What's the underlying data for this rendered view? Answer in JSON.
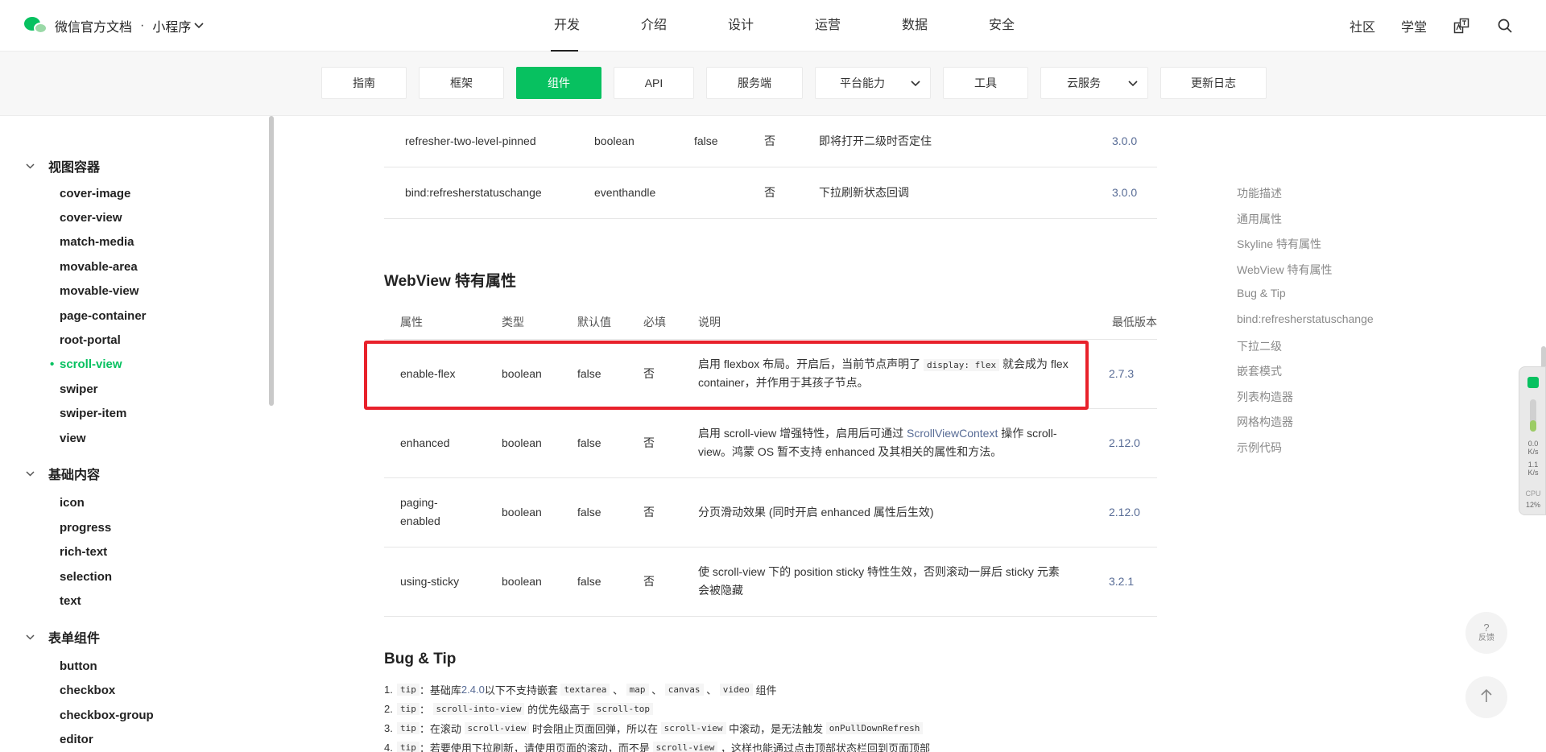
{
  "topnav": {
    "site_title": "微信官方文档",
    "separator": "·",
    "product": "小程序",
    "items": [
      "开发",
      "介绍",
      "设计",
      "运营",
      "数据",
      "安全"
    ],
    "active": "开发",
    "right_links": [
      "社区",
      "学堂"
    ]
  },
  "subnav": {
    "tabs": [
      "指南",
      "框架",
      "组件",
      "API",
      "服务端",
      "平台能力",
      "工具",
      "云服务",
      "更新日志"
    ],
    "active": "组件"
  },
  "sidebar": {
    "groups": [
      {
        "title": "视图容器",
        "items": [
          "cover-image",
          "cover-view",
          "match-media",
          "movable-area",
          "movable-view",
          "page-container",
          "root-portal",
          "scroll-view",
          "swiper",
          "swiper-item",
          "view"
        ]
      },
      {
        "title": "基础内容",
        "items": [
          "icon",
          "progress",
          "rich-text",
          "selection",
          "text"
        ]
      },
      {
        "title": "表单组件",
        "items": [
          "button",
          "checkbox",
          "checkbox-group",
          "editor"
        ]
      }
    ],
    "active_item": "scroll-view"
  },
  "prev_table": {
    "rows": [
      {
        "name": "refresher-two-level-pinned",
        "type": "boolean",
        "default": "false",
        "required": "否",
        "desc": "即将打开二级时否定住",
        "version": "3.0.0"
      },
      {
        "name": "bind:refresherstatuschange",
        "type": "eventhandle",
        "default": "",
        "required": "否",
        "desc": "下拉刷新状态回调",
        "version": "3.0.0"
      }
    ]
  },
  "webview": {
    "title": "WebView 特有属性",
    "headers": [
      "属性",
      "类型",
      "默认值",
      "必填",
      "说明",
      "最低版本"
    ],
    "rows": [
      {
        "name": "enable-flex",
        "type": "boolean",
        "default": "false",
        "required": "否",
        "desc_a": "启用 flexbox 布局。开启后，当前节点声明了",
        "desc_code": "display: flex",
        "desc_b": "就会成为 flex",
        "desc_c": "container，并作用于其孩子节点。",
        "version": "2.7.3"
      },
      {
        "name": "enhanced",
        "type": "boolean",
        "default": "false",
        "required": "否",
        "desc_a": "启用 scroll-view 增强特性，启用后可通过",
        "desc_link": "ScrollViewContext",
        "desc_b": "操作 scroll-",
        "desc_c": "view。鸿蒙 OS 暂不支持 enhanced 及其相关的属性和方法。",
        "version": "2.12.0"
      },
      {
        "name_a": "paging-",
        "name_b": "enabled",
        "type": "boolean",
        "default": "false",
        "required": "否",
        "desc_a": "分页滑动效果 (同时开启 enhanced 属性后生效)",
        "version": "2.12.0"
      },
      {
        "name": "using-sticky",
        "type": "boolean",
        "default": "false",
        "required": "否",
        "desc_a": "使 scroll-view 下的 position sticky 特性生效，否则滚动一屏后 sticky 元素",
        "desc_c": "会被隐藏",
        "version": "3.2.1"
      }
    ]
  },
  "bugtip": {
    "title": "Bug & Tip",
    "tip_label": "tip",
    "items": [
      {
        "num": "1.",
        "a": "：基础库",
        "link": "2.4.0",
        "b": "以下不支持嵌套",
        "codes": [
          "textarea",
          "map",
          "canvas",
          "video"
        ],
        "c": "组件"
      },
      {
        "num": "2.",
        "code1": "scroll-into-view",
        "a": "的优先级高于",
        "code2": "scroll-top"
      },
      {
        "num": "3.",
        "a": "：在滚动",
        "code1": "scroll-view",
        "b": "时会阻止页面回弹，所以在",
        "code2": "scroll-view",
        "c": "中滚动，是无法触发",
        "code3": "onPullDownRefresh"
      },
      {
        "num": "4.",
        "a": "：若要使用下拉刷新，请使用页面的滚动，而不是",
        "code1": "scroll-view",
        "b": "，这样也能通过点击顶部状态栏回到页面顶部"
      }
    ]
  },
  "toc": [
    "功能描述",
    "通用属性",
    "Skyline 特有属性",
    "WebView 特有属性",
    "Bug & Tip",
    "bind:refresherstatuschange",
    "下拉二级",
    "嵌套模式",
    "列表构造器",
    "网格构造器",
    "示例代码"
  ],
  "widgets": {
    "perf": {
      "v1": "0.0",
      "u1": "K/s",
      "v2": "1.1",
      "u2": "K/s",
      "cpu_label": "CPU",
      "cpu": "12%"
    },
    "feedback_q": "?",
    "feedback_label": "反馈"
  }
}
